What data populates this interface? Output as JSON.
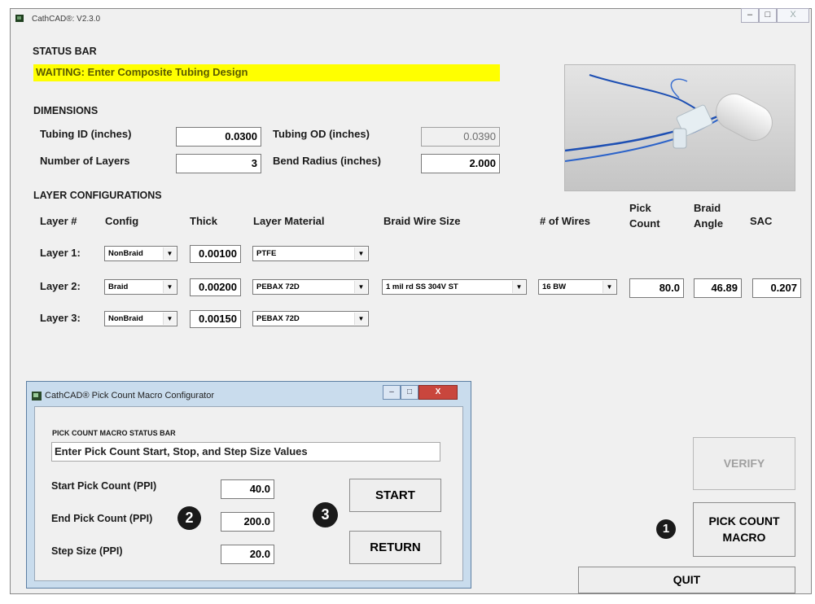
{
  "app": {
    "title": "CathCAD®: V2.3.0",
    "window_controls": {
      "minimize": "–",
      "maximize": "□",
      "close": "X"
    }
  },
  "status_bar": {
    "heading": "STATUS BAR",
    "message": "WAITING: Enter Composite Tubing Design"
  },
  "dimensions": {
    "heading": "DIMENSIONS",
    "tubing_id_label": "Tubing ID (inches)",
    "tubing_id_value": "0.0300",
    "tubing_od_label": "Tubing OD (inches)",
    "tubing_od_value": "0.0390",
    "num_layers_label": "Number of Layers",
    "num_layers_value": "3",
    "bend_radius_label": "Bend Radius (inches)",
    "bend_radius_value": "2.000"
  },
  "layers": {
    "heading": "LAYER CONFIGURATIONS",
    "columns": {
      "layer": "Layer #",
      "config": "Config",
      "thick": "Thick",
      "material": "Layer Material",
      "braid_wire": "Braid Wire Size",
      "wires": "# of Wires",
      "pick_count_1": "Pick",
      "pick_count_2": "Count",
      "braid_angle_1": "Braid",
      "braid_angle_2": "Angle",
      "sac": "SAC"
    },
    "rows": [
      {
        "label": "Layer 1:",
        "config": "NonBraid",
        "thick": "0.00100",
        "material": "PTFE"
      },
      {
        "label": "Layer 2:",
        "config": "Braid",
        "thick": "0.00200",
        "material": "PEBAX 72D",
        "braid_wire": "1 mil rd SS 304V ST",
        "wires": "16 BW",
        "pick_count": "80.0",
        "braid_angle": "46.89",
        "sac": "0.207"
      },
      {
        "label": "Layer 3:",
        "config": "NonBraid",
        "thick": "0.00150",
        "material": "PEBAX 72D"
      }
    ]
  },
  "buttons": {
    "verify": "VERIFY",
    "pick_count_macro_1": "PICK COUNT",
    "pick_count_macro_2": "MACRO",
    "quit": "QUIT"
  },
  "callouts": {
    "one": "1",
    "two": "2",
    "three": "3"
  },
  "dialog": {
    "title": "CathCAD® Pick Count Macro Configurator",
    "status_heading": "PICK COUNT MACRO STATUS BAR",
    "status_message": "Enter Pick Count Start, Stop, and Step Size Values",
    "start_label": "Start Pick Count (PPI)",
    "start_value": "40.0",
    "end_label": "End Pick Count (PPI)",
    "end_value": "200.0",
    "step_label": "Step Size (PPI)",
    "step_value": "20.0",
    "start_button": "START",
    "return_button": "RETURN",
    "controls": {
      "minimize": "–",
      "maximize": "□",
      "close": "X"
    }
  },
  "colors": {
    "status_bg": "#ffff00",
    "dialog_frame": "#c9dced",
    "close_button": "#c9463d"
  }
}
